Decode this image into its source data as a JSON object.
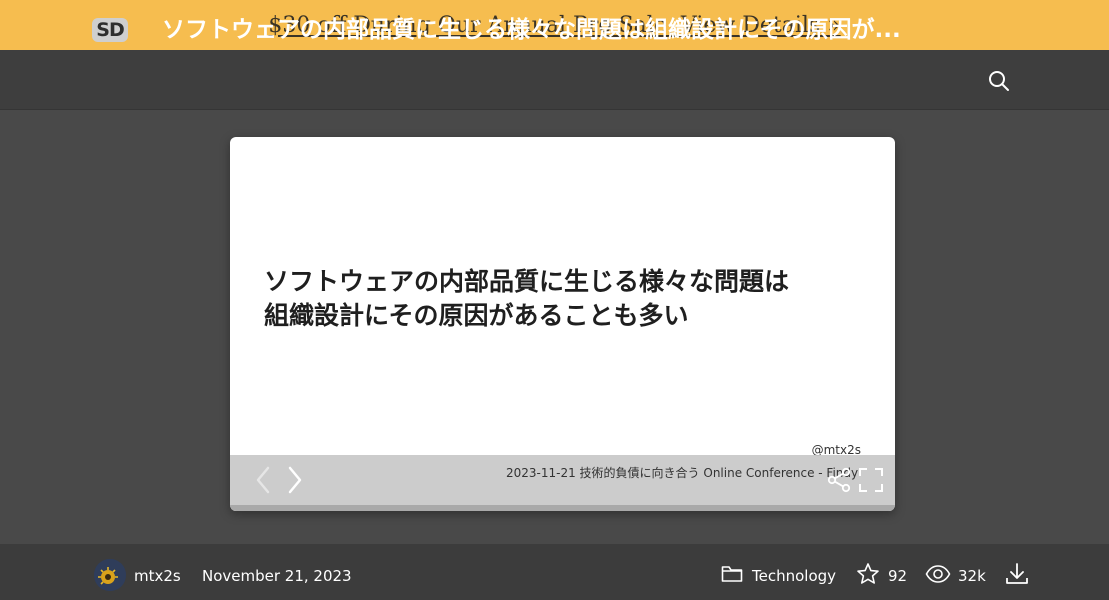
{
  "promo": {
    "text": "$30 off During Our Annual Pro Sale. View Details »"
  },
  "header": {
    "logo_text": "SD",
    "title": "ソフトウェアの内部品質に生じる様々な問題は組織設計にその原因が..."
  },
  "slide": {
    "line1": "ソフトウェアの内部品質に生じる様々な問題は",
    "line2": "組織設計にその原因があることも多い",
    "author_handle": "@mtx2s",
    "footer": "2023-11-21 技術的負債に向き合う Online Conference - Findy"
  },
  "meta": {
    "author": "mtx2s",
    "date": "November 21, 2023",
    "category": "Technology",
    "stars": "92",
    "views": "32k"
  },
  "icons": {
    "search": "search-icon",
    "prev": "chevron-left-icon",
    "next": "chevron-right-icon",
    "share": "share-icon",
    "fullscreen": "fullscreen-icon",
    "folder": "folder-icon",
    "star": "star-icon",
    "eye": "eye-icon",
    "download": "download-icon"
  },
  "colors": {
    "promo_bg": "#f6bd4f",
    "page_bg": "#4a4a4a",
    "header_bg": "#3e3e3e"
  }
}
